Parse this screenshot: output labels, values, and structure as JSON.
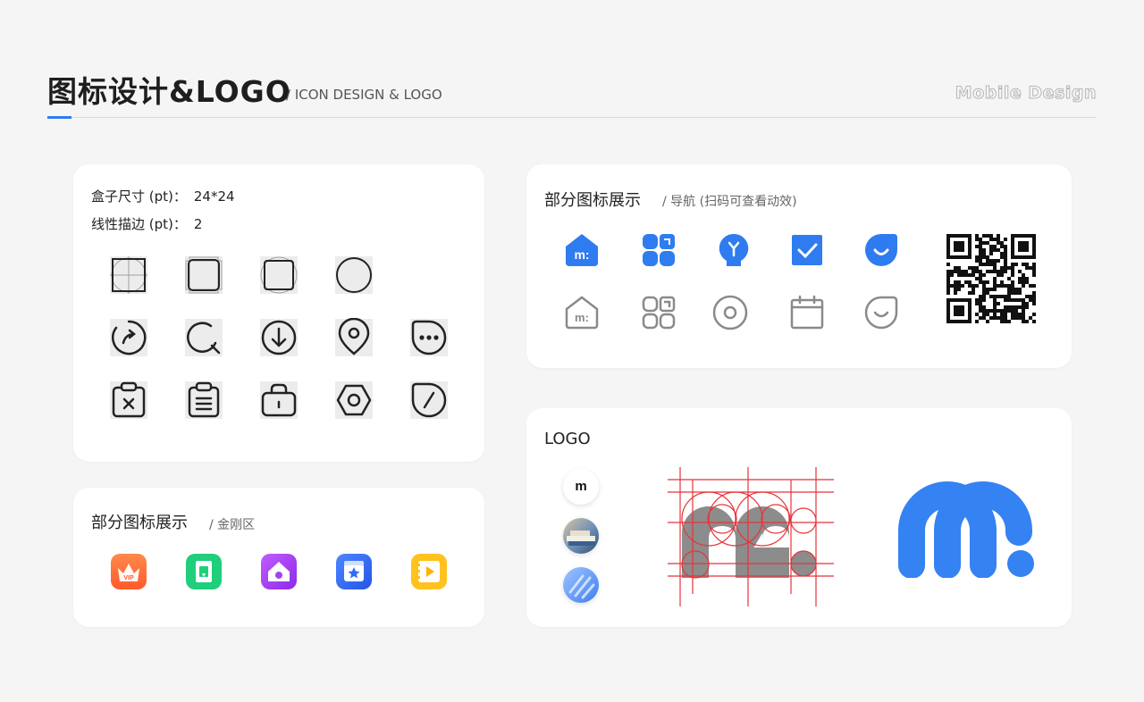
{
  "header": {
    "title": "图标设计&LOGO",
    "subtitle": "/ ICON DESIGN & LOGO",
    "brand": "Mobile Design",
    "accent_color": "#2f7cf0"
  },
  "spec_card": {
    "box_label": "盒子尺寸 (pt)：",
    "box_value": "24*24",
    "stroke_label": "线性描边 (pt)：",
    "stroke_value": "2",
    "icons": [
      "square-grid-icon",
      "rounded-square-grid-icon",
      "rounded-square-grid-icon",
      "circle-grid-icon",
      "share-icon",
      "search-icon",
      "download-icon",
      "location-pin-icon",
      "more-icon",
      "clipboard-delete-icon",
      "clipboard-list-icon",
      "bag-icon",
      "settings-hexagon-icon",
      "link-icon"
    ]
  },
  "kingkong_card": {
    "title": "部分图标展示",
    "subtitle": "/ 金刚区",
    "badge_text": "VIP",
    "icons": [
      "vip-crown-icon",
      "book-green-icon",
      "home-purple-icon",
      "star-blue-icon",
      "play-yellow-icon"
    ],
    "colors": [
      "#ff6a3d",
      "#1fcf7b",
      "#a243f0",
      "#2f6df2",
      "#ffc21e"
    ]
  },
  "nav_card": {
    "title": "部分图标展示",
    "subtitle": "/ 导航 (扫码可查看动效)",
    "active_color": "#2f7cf0",
    "inactive_color": "#8a8a8a",
    "active_icons": [
      "home-active-icon",
      "category-active-icon",
      "lightbulb-active-icon",
      "check-active-icon",
      "profile-active-icon"
    ],
    "inactive_icons": [
      "home-icon",
      "category-icon",
      "target-icon",
      "calendar-icon",
      "profile-icon"
    ],
    "home_glyph": "m:"
  },
  "logo_card": {
    "title": "LOGO",
    "small_mark": "m",
    "logo_color": "#3582f3",
    "grid_color": "#e8323a"
  }
}
